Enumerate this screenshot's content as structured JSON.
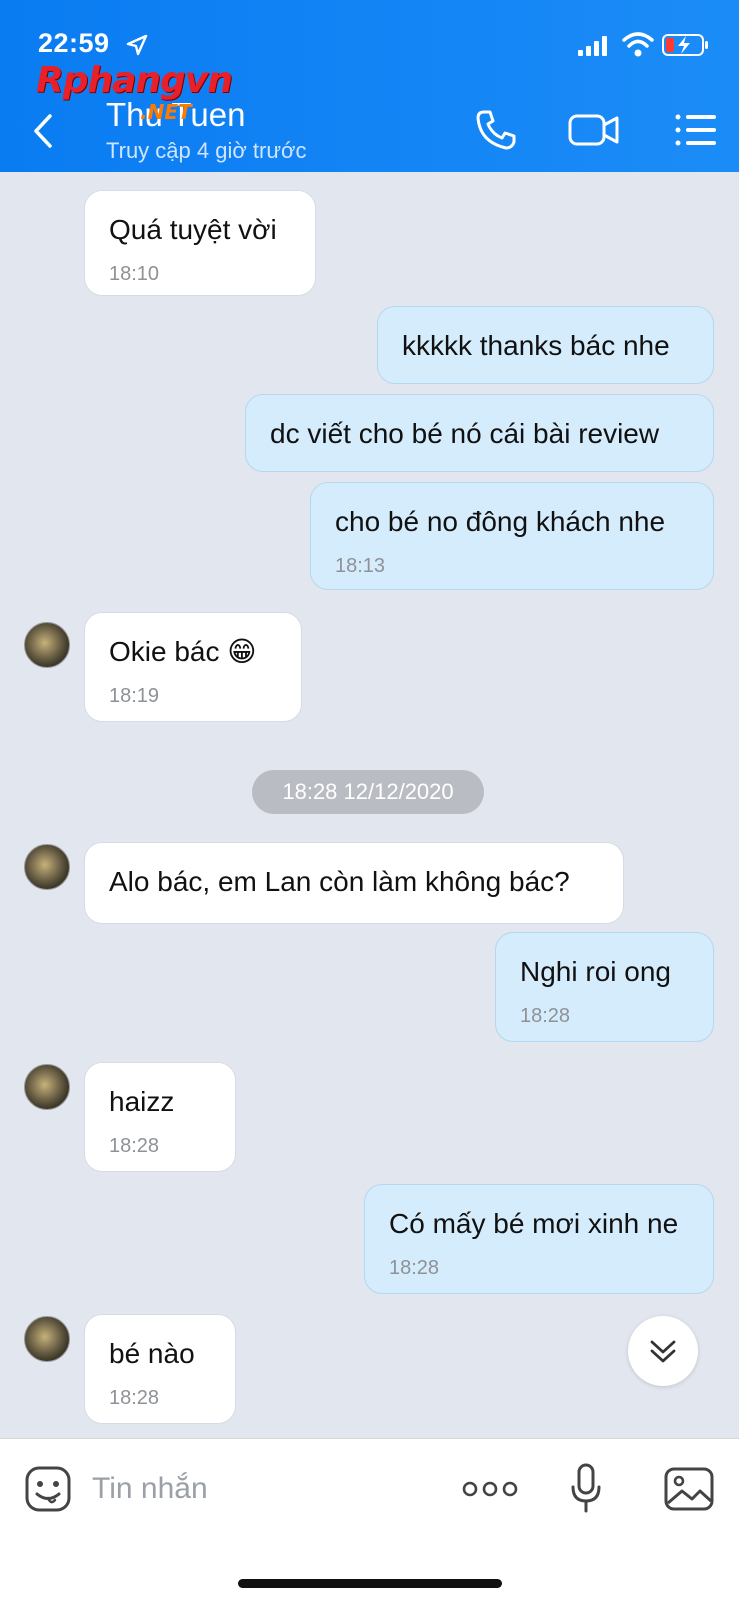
{
  "status_bar": {
    "time": "22:59"
  },
  "watermark": {
    "brand": "Rphangvn",
    "suffix": ".NET"
  },
  "header": {
    "contact_name": "Thu Tuen",
    "contact_status": "Truy cập 4 giờ trước"
  },
  "messages": [
    {
      "direction": "in",
      "text": "Quá tuyệt vời",
      "time": "18:10"
    },
    {
      "direction": "out",
      "text": "kkkkk thanks bác nhe"
    },
    {
      "direction": "out",
      "text": "dc viết cho bé nó cái bài review"
    },
    {
      "direction": "out",
      "text": "cho bé no đông khách nhe",
      "time": "18:13"
    },
    {
      "direction": "in",
      "text": "Okie bác 😁",
      "time": "18:19"
    },
    {
      "direction": "in",
      "text": "Alo bác, em Lan còn làm không bác?"
    },
    {
      "direction": "out",
      "text": "Nghi roi ong",
      "time": "18:28"
    },
    {
      "direction": "in",
      "text": "haizz",
      "time": "18:28"
    },
    {
      "direction": "out",
      "text": "Có mấy bé mơi xinh ne",
      "time": "18:28"
    },
    {
      "direction": "in",
      "text": "bé nào",
      "time": "18:28"
    }
  ],
  "date_separator": "18:28 12/12/2020",
  "input": {
    "placeholder": "Tin nhắn"
  },
  "colors": {
    "header": "#0a7cf2",
    "chat_bg": "#e2e6ef",
    "out_bubble": "#d5ecfc",
    "in_bubble": "#ffffff"
  }
}
